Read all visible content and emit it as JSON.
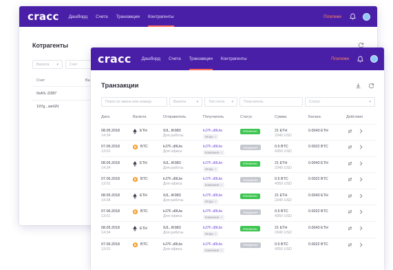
{
  "app": {
    "logo": "cracc",
    "nav": [
      "Дашборд",
      "Счета",
      "Транзакции",
      "Контрагенты"
    ],
    "payments_label": "Платежи"
  },
  "back": {
    "active_nav": 3,
    "title": "Котрагенты",
    "filters": [
      {
        "label": "Валюта",
        "chevron": "▾"
      },
      {
        "label": "Счет",
        "chevron": ""
      }
    ],
    "columns": [
      "Счет",
      "Ва"
    ],
    "rows": [
      {
        "account": "0xAS..D387",
        "coin": "btc"
      },
      {
        "account": "197g...weGN",
        "coin": "btc"
      }
    ]
  },
  "front": {
    "active_nav": 2,
    "title": "Транзакции",
    "filters": [
      {
        "label": "Поиск по имени или номеру",
        "chevron": ""
      },
      {
        "label": "Валюта",
        "chevron": "▾"
      },
      {
        "label": "Тип счета",
        "chevron": "▾"
      },
      {
        "label": "Получатель",
        "chevron": ""
      },
      {
        "label": "Статус",
        "chevron": "▾"
      }
    ],
    "columns": [
      "Дата",
      "Валюта",
      "Отправитель",
      "Получатель",
      "Статус",
      "Сумма",
      "Баланс",
      "Действия"
    ],
    "rows": [
      {
        "date": "08.05.2018",
        "time": "14:34",
        "currency": "ETH",
        "coin": "eth",
        "sender": "9JL..IK983",
        "sender_sub": "Для работы",
        "receiver": "kJ7F..d9Uw",
        "receiver_tag": "Игорь",
        "status": "Оплачено",
        "status_type": "ok",
        "amount": "21 ETH",
        "amount_sub": "2340 USD",
        "balance": "0.0043 ETH"
      },
      {
        "date": "07.06.2018",
        "time": "13:01",
        "currency": "BTC",
        "coin": "btc",
        "sender": "kJ7F..d9Uw",
        "sender_sub": "Для офиса",
        "receiver": "kJ7F..d9Uw",
        "receiver_tag": "Компания",
        "status": "Ожидание",
        "status_type": "wait",
        "amount": "0.5 BTC",
        "amount_sub": "4350 USD",
        "balance": "0.0022 BTC"
      },
      {
        "date": "08.05.2018",
        "time": "14:34",
        "currency": "ETH",
        "coin": "eth",
        "sender": "9JL..IK983",
        "sender_sub": "Для работы",
        "receiver": "kJ7F..d9Uw",
        "receiver_tag": "Игорь",
        "status": "Оплачено",
        "status_type": "ok",
        "amount": "21 ETH",
        "amount_sub": "2340 USD",
        "balance": "0.0043 ETH"
      },
      {
        "date": "07.06.2018",
        "time": "13:01",
        "currency": "BTC",
        "coin": "btc",
        "sender": "kJ7F..d9Uw",
        "sender_sub": "Для офиса",
        "receiver": "kJ7F..d9Uw",
        "receiver_tag": "Компания",
        "status": "Ожидание",
        "status_type": "wait",
        "amount": "0.5 BTC",
        "amount_sub": "4350 USD",
        "balance": "0.0022 BTC"
      },
      {
        "date": "08.05.2018",
        "time": "14:34",
        "currency": "ETH",
        "coin": "eth",
        "sender": "9JL..IK983",
        "sender_sub": "Для работы",
        "receiver": "kJ7F..d9Uw",
        "receiver_tag": "Игорь",
        "status": "Оплачено",
        "status_type": "ok",
        "amount": "21 ETH",
        "amount_sub": "2340 USD",
        "balance": "0.0043 ETH"
      },
      {
        "date": "07.06.2018",
        "time": "13:01",
        "currency": "BTC",
        "coin": "btc",
        "sender": "kJ7F..d9Uw",
        "sender_sub": "Для офиса",
        "receiver": "kJ7F..d9Uw",
        "receiver_tag": "Компания",
        "status": "Ожидание",
        "status_type": "wait",
        "amount": "0.5 BTC",
        "amount_sub": "4350 USD",
        "balance": "0.0022 BTC"
      },
      {
        "date": "08.05.2018",
        "time": "14:34",
        "currency": "ETH",
        "coin": "eth",
        "sender": "9JL..IK983",
        "sender_sub": "Для работы",
        "receiver": "kJ7F..d9Uw",
        "receiver_tag": "Игорь",
        "status": "Оплачено",
        "status_type": "ok",
        "amount": "21 ETH",
        "amount_sub": "2340 USD",
        "balance": "0.0043 ETH"
      },
      {
        "date": "07.06.2018",
        "time": "13:01",
        "currency": "BTC",
        "coin": "btc",
        "sender": "kJ7F..d9Uw",
        "sender_sub": "Для офиса",
        "receiver": "kJ7F..d9Uw",
        "receiver_tag": "Компания",
        "status": "Ожидание",
        "status_type": "wait",
        "amount": "0.5 BTC",
        "amount_sub": "4350 USD",
        "balance": "0.0022 BTC"
      }
    ]
  },
  "icons": {
    "bell": "bell-icon",
    "avatar": "avatar",
    "download": "download-icon",
    "refresh": "refresh-icon",
    "exchange": "exchange-icon",
    "chevron": "chevron-right-icon",
    "eth": "ethereum-icon",
    "btc": "bitcoin-icon"
  },
  "colors": {
    "topbar": "#4a1fa8",
    "accent": "#ff6b5b",
    "payments": "#ff8a5c",
    "receiver": "#6b3fd4",
    "paid": "#3cc54f",
    "pending": "#c5c7cf",
    "btc": "#f7931a"
  }
}
